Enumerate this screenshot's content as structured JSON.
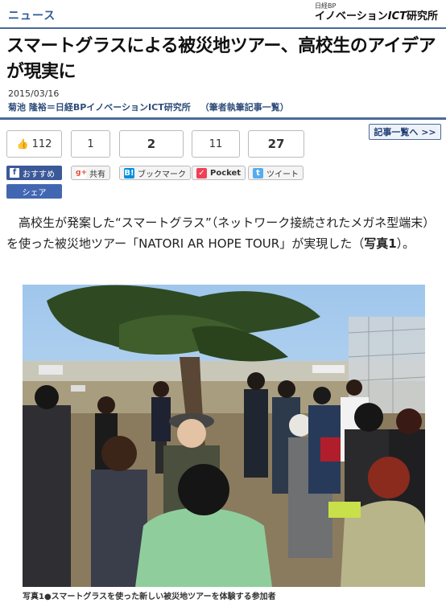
{
  "header": {
    "section": "ニュース",
    "brand_small": "日経BP",
    "brand_main_prefix": "イノベーション",
    "brand_main_ict": "ICT",
    "brand_main_suffix": "研究所"
  },
  "article": {
    "title": "スマートグラスによる被災地ツアー、高校生のアイデアが現実に",
    "date": "2015/03/16",
    "author": "菊池 隆裕＝日経BPイノベーションICT研究所",
    "author_link": "（筆者執筆記事一覧）",
    "body_1": "高校生が発案した“スマートグラス”（ネットワーク接続されたメガネ型端末）を使った被災地ツアー「NATORI AR HOPE TOUR」が実現した（",
    "body_bold": "写真1",
    "body_2": "）。",
    "photo_caption": "写真1●スマートグラスを使った新しい被災地ツアーを体験する参加者"
  },
  "social": {
    "fb_count": "112",
    "google_count": "1",
    "hatena_count": "2",
    "pocket_count": "11",
    "twitter_count": "27",
    "fb_recommend_label": "おすすめ",
    "fb_share_label": "シェア",
    "google_label": "共有",
    "hatena_label": "ブックマーク",
    "pocket_label": "Pocket",
    "twitter_label": "ツイート"
  },
  "nav": {
    "article_list": "記事一覧へ >>"
  },
  "colors": {
    "accent": "#4a6a9a",
    "facebook": "#3b5998",
    "google": "#dd4b39",
    "hatena": "#008fde",
    "pocket": "#ef4056",
    "twitter": "#55acee"
  }
}
